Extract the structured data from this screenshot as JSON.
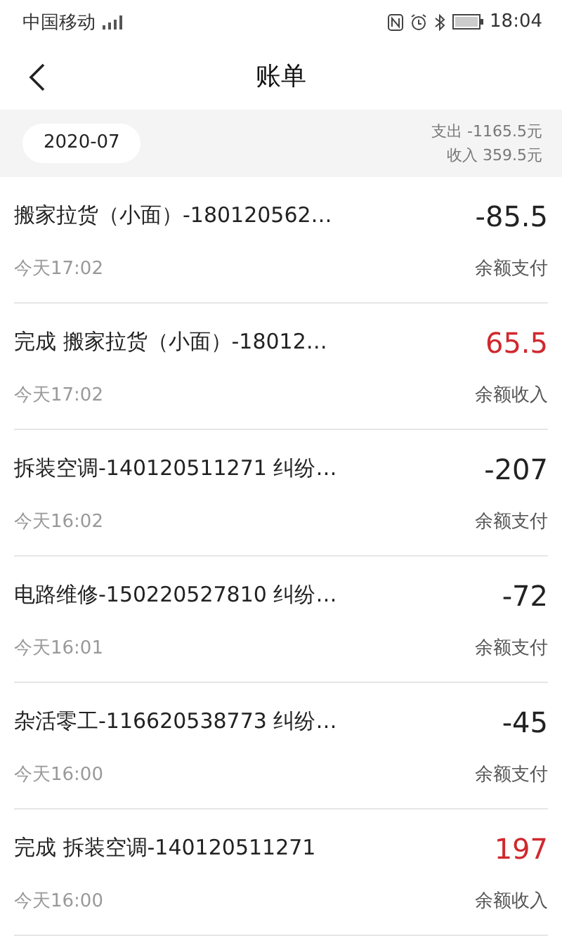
{
  "status_bar": {
    "carrier": "中国移动",
    "time": "18:04"
  },
  "header": {
    "title": "账单"
  },
  "summary": {
    "month": "2020-07",
    "expense": "支出 -1165.5元",
    "income": "收入 359.5元"
  },
  "records": [
    {
      "title": "搬家拉货（小面）-180120562…",
      "time": "今天17:02",
      "amount": "-85.5",
      "method": "余额支付",
      "kind": "expense"
    },
    {
      "title": "完成 搬家拉货（小面）-18012…",
      "time": "今天17:02",
      "amount": "65.5",
      "method": "余额收入",
      "kind": "income"
    },
    {
      "title": "拆装空调-140120511271 纠纷…",
      "time": "今天16:02",
      "amount": "-207",
      "method": "余额支付",
      "kind": "expense"
    },
    {
      "title": "电路维修-150220527810 纠纷…",
      "time": "今天16:01",
      "amount": "-72",
      "method": "余额支付",
      "kind": "expense"
    },
    {
      "title": "杂活零工-116620538773 纠纷…",
      "time": "今天16:00",
      "amount": "-45",
      "method": "余额支付",
      "kind": "expense"
    },
    {
      "title": "完成 拆装空调-140120511271",
      "time": "今天16:00",
      "amount": "197",
      "method": "余额收入",
      "kind": "income"
    }
  ]
}
